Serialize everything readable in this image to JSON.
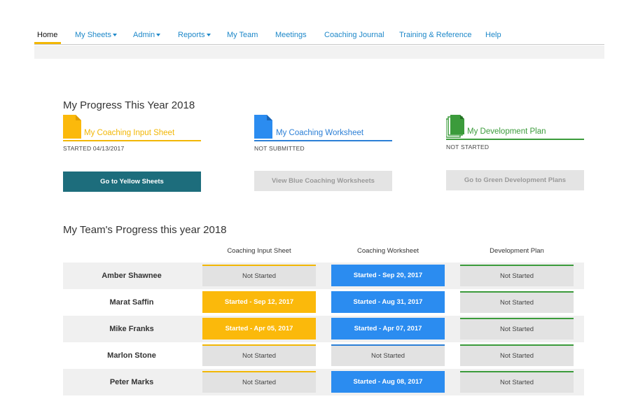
{
  "nav": {
    "items": [
      {
        "label": "Home",
        "active": true
      },
      {
        "label": "My Sheets",
        "dropdown": true
      },
      {
        "label": "Admin",
        "dropdown": true
      },
      {
        "label": "Reports",
        "dropdown": true
      },
      {
        "label": "My Team"
      },
      {
        "label": "Meetings"
      },
      {
        "label": "Coaching Journal"
      },
      {
        "label": "Training & Reference"
      },
      {
        "label": "Help"
      }
    ]
  },
  "progress": {
    "title": "My Progress This Year 2018",
    "cards": [
      {
        "label": "My Coaching Input Sheet",
        "status": "STARTED 04/13/2017",
        "button": "Go to Yellow Sheets",
        "color": "#f2b705",
        "icon": "yellow-document-icon"
      },
      {
        "label": "My Coaching Worksheet",
        "status": "NOT SUBMITTED",
        "button": "View Blue Coaching Worksheets",
        "color": "#2b7fd6",
        "icon": "blue-document-icon"
      },
      {
        "label": "My Development Plan",
        "status": "NOT STARTED",
        "button": "Go to Green Development Plans",
        "color": "#3b9b3b",
        "icon": "green-stacked-documents-icon"
      }
    ]
  },
  "team": {
    "title": "My Team's Progress this year 2018",
    "columns": [
      "Coaching Input Sheet",
      "Coaching Worksheet",
      "Development Plan"
    ],
    "rows": [
      {
        "name": "Amber Shawnee",
        "cells": [
          "Not Started",
          "Started - Sep 20, 2017",
          "Not Started"
        ]
      },
      {
        "name": "Marat Saffin",
        "cells": [
          "Started - Sep 12, 2017",
          "Started - Aug 31, 2017",
          "Not Started"
        ]
      },
      {
        "name": "Mike Franks",
        "cells": [
          "Started - Apr 05, 2017",
          "Started - Apr 07, 2017",
          "Not Started"
        ]
      },
      {
        "name": "Marlon Stone",
        "cells": [
          "Not Started",
          "Not Started",
          "Not Started"
        ]
      },
      {
        "name": "Peter Marks",
        "cells": [
          "Not Started",
          "Started - Aug 08, 2017",
          "Not Started"
        ]
      }
    ]
  },
  "colors": {
    "yellow": "#fbb90b",
    "blue": "#2b8cf0",
    "green": "#3b9b3b",
    "teal": "#1d6d7c",
    "link": "#1e88c9"
  }
}
